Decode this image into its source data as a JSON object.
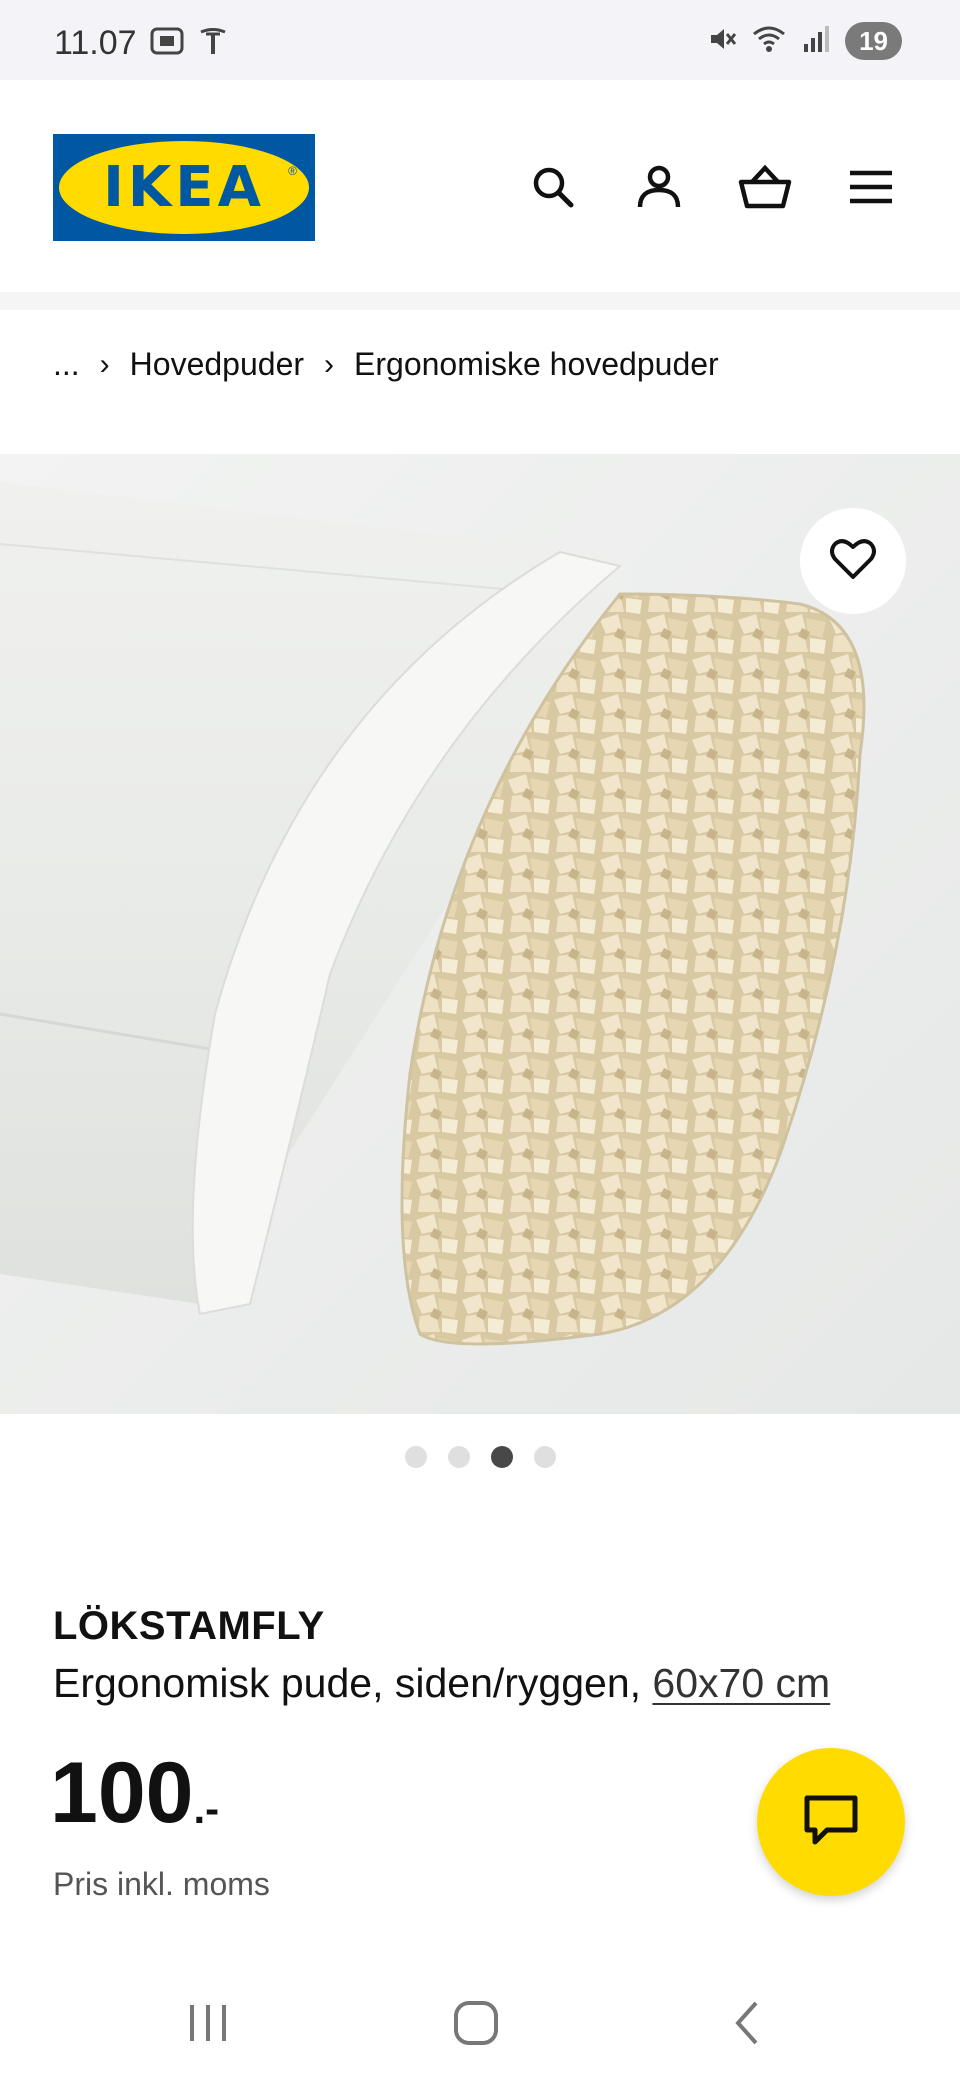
{
  "status_bar": {
    "time": "11.07",
    "battery": "19",
    "left_icons": [
      "screenshot-icon",
      "tesla-icon"
    ],
    "right_icons": [
      "mute-icon",
      "wifi-icon",
      "signal-icon"
    ]
  },
  "header": {
    "logo_text": "IKEA",
    "logo_colors": {
      "blue": "#0058a3",
      "yellow": "#ffdb00"
    },
    "icons": [
      "search-icon",
      "account-icon",
      "basket-icon",
      "menu-icon"
    ]
  },
  "breadcrumb": {
    "items": [
      "...",
      "Hovedpuder",
      "Ergonomiske hovedpuder"
    ]
  },
  "gallery": {
    "total": 4,
    "active_index": 2
  },
  "product": {
    "name": "LÖKSTAMFLY",
    "description": "Ergonomisk pude, siden/ryggen,",
    "size": "60x70 cm",
    "price": "100",
    "price_suffix": ".-",
    "price_note": "Pris inkl. moms"
  },
  "accent_color": "#ffdb00"
}
